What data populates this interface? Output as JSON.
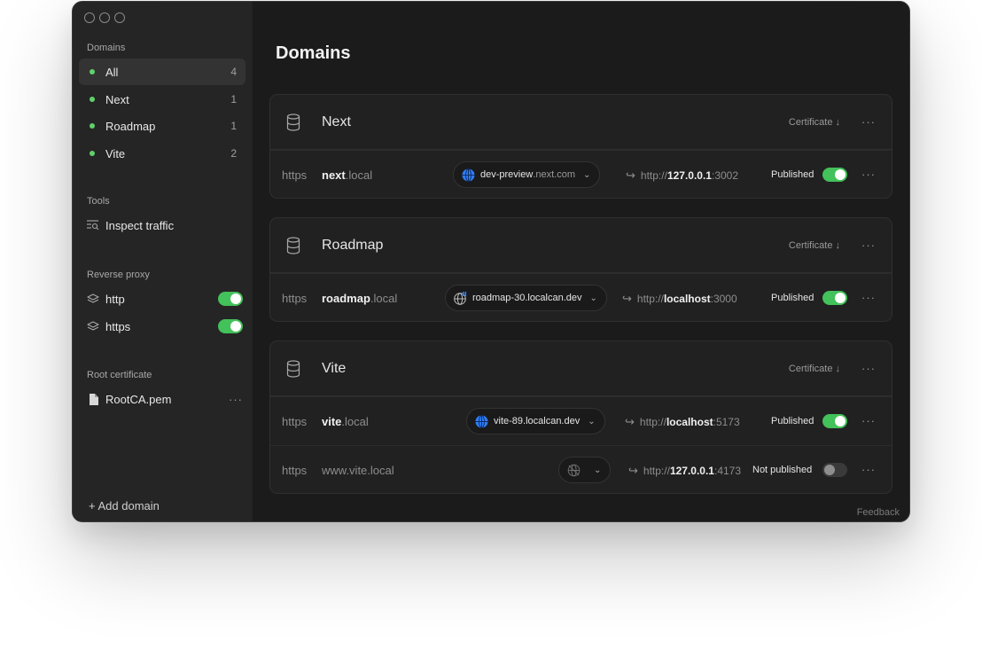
{
  "sidebar": {
    "domains_title": "Domains",
    "domains": [
      {
        "label": "All",
        "count": "4"
      },
      {
        "label": "Next",
        "count": "1"
      },
      {
        "label": "Roadmap",
        "count": "1"
      },
      {
        "label": "Vite",
        "count": "2"
      }
    ],
    "tools_title": "Tools",
    "tools": [
      {
        "label": "Inspect traffic",
        "icon": "inspect-traffic-icon"
      }
    ],
    "proxy_title": "Reverse proxy",
    "proxies": [
      {
        "label": "http",
        "icon": "layers-icon",
        "enabled": true
      },
      {
        "label": "https",
        "icon": "layers-icon",
        "enabled": true
      }
    ],
    "cert_title": "Root certificate",
    "cert_file": "RootCA.pem",
    "more": "···",
    "add_domain": "+ Add domain"
  },
  "main": {
    "title": "Domains",
    "certificate_label": "Certificate ↓",
    "more": "···",
    "feedback": "Feedback",
    "groups": [
      {
        "name": "Next",
        "rows": [
          {
            "protocol": "https",
            "sub": "next",
            "suffix": ".local",
            "prefix": "",
            "pill_main": "dev-preview",
            "pill_muted": ".next.com",
            "pill_icon": "globe-icon",
            "target_scheme": "http://",
            "target_host": "127.0.0.1",
            "target_port": ":3002",
            "status": "Published",
            "published": true
          }
        ]
      },
      {
        "name": "Roadmap",
        "rows": [
          {
            "protocol": "https",
            "sub": "roadmap",
            "suffix": ".local",
            "prefix": "",
            "pill_main": "roadmap-30.localcan.dev",
            "pill_muted": "",
            "pill_icon": "globe-warning-icon",
            "target_scheme": "http://",
            "target_host": "localhost",
            "target_port": ":3000",
            "status": "Published",
            "published": true
          }
        ]
      },
      {
        "name": "Vite",
        "rows": [
          {
            "protocol": "https",
            "sub": "vite",
            "suffix": ".local",
            "prefix": "",
            "pill_main": "vite-89.localcan.dev",
            "pill_muted": "",
            "pill_icon": "globe-icon",
            "target_scheme": "http://",
            "target_host": "localhost",
            "target_port": ":5173",
            "status": "Published",
            "published": true
          },
          {
            "protocol": "https",
            "sub": "",
            "suffix": "www.vite.local",
            "prefix": "",
            "pill_main": "",
            "pill_muted": "",
            "pill_icon": "globe-off-icon",
            "target_scheme": "http://",
            "target_host": "127.0.0.1",
            "target_port": ":4173",
            "status": "Not published",
            "published": false
          }
        ]
      }
    ]
  },
  "colors": {
    "accent_green": "#43c15a",
    "dot_green": "#5fd16b",
    "globe_blue": "#2f7df6"
  }
}
